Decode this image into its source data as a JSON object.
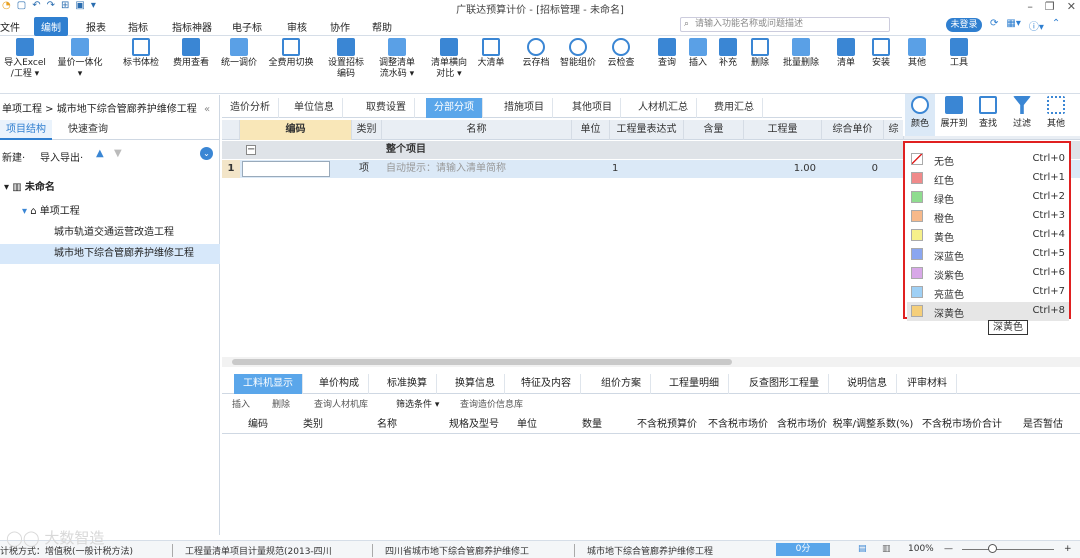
{
  "titlebar": {
    "title": "广联达预算计价 - [招标管理 - 未命名]",
    "qa_icons": [
      "logo-icon",
      "new-icon",
      "undo-icon",
      "redo-icon",
      "open-icon",
      "save-icon",
      "more-icon"
    ]
  },
  "menubar": {
    "items": [
      "文件",
      "编制",
      "报表",
      "指标",
      "指标神器",
      "电子标",
      "审核",
      "协作",
      "帮助"
    ],
    "active": "编制"
  },
  "search": {
    "placeholder": "请输入功能名称或问题描述"
  },
  "login": "未登录",
  "ribbon": {
    "buttons": [
      {
        "label": "导入Excel\n/工程 ▾",
        "icon": "import-excel-icon"
      },
      {
        "label": "量价一体化\n▾",
        "icon": "integration-icon"
      },
      {
        "label": "标书体检",
        "icon": "check-icon"
      },
      {
        "label": "费用查看",
        "icon": "fee-view-icon"
      },
      {
        "label": "统一调价",
        "icon": "adjust-price-icon"
      },
      {
        "label": "全费用切换",
        "icon": "switch-icon"
      },
      {
        "label": "设置招标\n编码",
        "icon": "code-icon"
      },
      {
        "label": "调整清单\n流水码 ▾",
        "icon": "flow-code-icon"
      },
      {
        "label": "清单横向\n对比 ▾",
        "icon": "compare-icon"
      },
      {
        "label": "大清单",
        "icon": "big-list-icon"
      },
      {
        "label": "云存档",
        "icon": "cloud-save-icon"
      },
      {
        "label": "智能组价",
        "icon": "smart-price-icon"
      },
      {
        "label": "云检查",
        "icon": "cloud-check-icon"
      },
      {
        "label": "查询",
        "icon": "query-icon"
      },
      {
        "label": "插入",
        "icon": "insert-icon"
      },
      {
        "label": "补充",
        "icon": "supplement-icon"
      },
      {
        "label": "删除",
        "icon": "delete-icon"
      },
      {
        "label": "批量删除",
        "icon": "batch-delete-icon"
      },
      {
        "label": "清单",
        "icon": "list-icon"
      },
      {
        "label": "安装",
        "icon": "install-icon"
      },
      {
        "label": "其他",
        "icon": "other-icon"
      },
      {
        "label": "工具",
        "icon": "tool-icon"
      }
    ]
  },
  "left": {
    "breadcrumb": "单项工程 > 城市地下综合管廊养护维修工程",
    "tabs": [
      "项目结构",
      "快速查询"
    ],
    "tools": {
      "new": "新建·",
      "importexport": "导入导出·"
    },
    "tree": [
      {
        "label": "未命名",
        "level": 0,
        "icon": "building-icon"
      },
      {
        "label": "单项工程",
        "level": 1,
        "icon": "home-icon"
      },
      {
        "label": "城市轨道交通运营改造工程",
        "level": 2
      },
      {
        "label": "城市地下综合管廊养护维修工程",
        "level": 2,
        "selected": true
      }
    ]
  },
  "main": {
    "tabs": [
      "造价分析",
      "单位信息",
      "取费设置",
      "分部分项",
      "措施项目",
      "其他项目",
      "人材机汇总",
      "费用汇总"
    ],
    "active_tab": "分部分项",
    "columns": [
      "编码",
      "类别",
      "名称",
      "单位",
      "工程量表达式",
      "含量",
      "工程量",
      "综合单价",
      "综"
    ],
    "rows": [
      {
        "no": "",
        "code": "−",
        "type": "",
        "name": "整个项目",
        "unit": "",
        "expr": "",
        "amount": "",
        "qty": "",
        "price": ""
      },
      {
        "no": "1",
        "code": "",
        "type": "项",
        "name": "自动提示：请输入清单简称",
        "unit": "",
        "expr": "1",
        "amount": "",
        "qty": "1.00",
        "price": "0"
      }
    ]
  },
  "bottom": {
    "tabs": [
      "工料机显示",
      "单价构成",
      "标准换算",
      "换算信息",
      "特征及内容",
      "组价方案",
      "工程量明细",
      "反查图形工程量",
      "说明信息",
      "评审材料"
    ],
    "active_tab": "工料机显示",
    "tools": [
      "插入",
      "删除",
      "查询人材机库",
      "筛选条件 ▾",
      "查询造价信息库"
    ],
    "columns": [
      "编码",
      "类别",
      "名称",
      "规格及型号",
      "单位",
      "数量",
      "不含税预算价",
      "不含税市场价",
      "含税市场价",
      "税率/调整系数(%)",
      "不含税市场价合计",
      "是否暂估"
    ]
  },
  "rightpanel": {
    "buttons": [
      {
        "label": "颜色",
        "icon": "color-icon"
      },
      {
        "label": "展开到",
        "icon": "expand-icon"
      },
      {
        "label": "查找",
        "icon": "find-icon"
      },
      {
        "label": "过滤",
        "icon": "filter-icon"
      },
      {
        "label": "其他",
        "icon": "other-icon"
      }
    ]
  },
  "color_menu": {
    "items": [
      {
        "label": "无色",
        "shortcut": "Ctrl+0",
        "color": "#ffffff"
      },
      {
        "label": "红色",
        "shortcut": "Ctrl+1",
        "color": "#f08a8a"
      },
      {
        "label": "绿色",
        "shortcut": "Ctrl+2",
        "color": "#8fdc8f"
      },
      {
        "label": "橙色",
        "shortcut": "Ctrl+3",
        "color": "#f7b98a"
      },
      {
        "label": "黄色",
        "shortcut": "Ctrl+4",
        "color": "#f6f08a"
      },
      {
        "label": "深蓝色",
        "shortcut": "Ctrl+5",
        "color": "#8aa6f0"
      },
      {
        "label": "淡紫色",
        "shortcut": "Ctrl+6",
        "color": "#d8a8e8"
      },
      {
        "label": "亮蓝色",
        "shortcut": "Ctrl+7",
        "color": "#9fd0f5"
      },
      {
        "label": "深黄色",
        "shortcut": "Ctrl+8",
        "color": "#f5cf7a"
      }
    ],
    "hovered": "深黄色",
    "tooltip": "深黄色"
  },
  "status": {
    "tax": "计税方式：增值税(一般计税方法)",
    "spec": "工程量清单项目计量规范(2013-四川",
    "std": "四川省城市地下综合管廊养护维修工",
    "project": "城市地下综合管廊养护维修工程",
    "score": "0分",
    "zoom": "100%"
  },
  "colors": {
    "accent": "#2f7fd0",
    "tab_active": "#5aa6ea",
    "code_header": "#f9e7b8",
    "popup_border": "#e02020",
    "row_selected": "#dbe9f7"
  }
}
